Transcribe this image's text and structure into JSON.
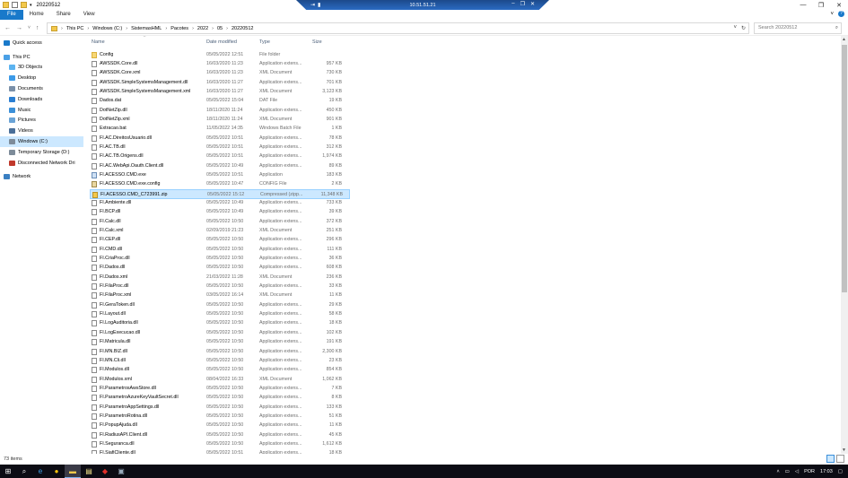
{
  "window": {
    "title": "20220512",
    "quick_access_icons": [
      "save-icon",
      "folder-icon",
      "dropdown-icon"
    ],
    "controls": [
      "—",
      "❐",
      "✕"
    ]
  },
  "rdp_bar": {
    "host_label": "10.51.51.21",
    "left_icons": [
      "pin-icon",
      "signal-icon"
    ],
    "right_controls": [
      "–",
      "❐",
      "✕"
    ]
  },
  "ribbon": {
    "tabs": [
      "File",
      "Home",
      "Share",
      "View"
    ],
    "right_icons": [
      "chevron-down-icon",
      "help-icon"
    ]
  },
  "address": {
    "nav": [
      "←",
      "→",
      "˅",
      "↑"
    ],
    "crumbs": [
      "This PC",
      "Windows (C:)",
      "SistemasHML",
      "Pacotes",
      "2022",
      "05",
      "20220512"
    ],
    "search_placeholder": "Search 20220512"
  },
  "nav_pane": [
    {
      "label": "Quick access",
      "icon": "star-icon",
      "indent": 0,
      "color": "#1979ca"
    },
    {
      "label": "This PC",
      "icon": "computer-icon",
      "indent": 0,
      "color": "#4aa0e6"
    },
    {
      "label": "3D Objects",
      "icon": "cube-icon",
      "indent": 1,
      "color": "#5cb3f0"
    },
    {
      "label": "Desktop",
      "icon": "desktop-icon",
      "indent": 1,
      "color": "#3c9ae8"
    },
    {
      "label": "Documents",
      "icon": "documents-icon",
      "indent": 1,
      "color": "#7a8fa8"
    },
    {
      "label": "Downloads",
      "icon": "download-icon",
      "indent": 1,
      "color": "#2a7ed2"
    },
    {
      "label": "Music",
      "icon": "music-icon",
      "indent": 1,
      "color": "#3a8fd8"
    },
    {
      "label": "Pictures",
      "icon": "pictures-icon",
      "indent": 1,
      "color": "#6aa3d6"
    },
    {
      "label": "Videos",
      "icon": "video-icon",
      "indent": 1,
      "color": "#4a6f99"
    },
    {
      "label": "Windows (C:)",
      "icon": "drive-icon",
      "indent": 1,
      "color": "#7d8b99",
      "selected": true
    },
    {
      "label": "Temporary Storage (D:)",
      "icon": "drive-icon",
      "indent": 1,
      "color": "#7d8b99"
    },
    {
      "label": "Disconnected Network Dri",
      "icon": "network-drive-icon",
      "indent": 1,
      "color": "#c0392b"
    },
    {
      "label": "Network",
      "icon": "network-icon",
      "indent": 0,
      "color": "#3a7fc2"
    }
  ],
  "columns": {
    "name": "Name",
    "date": "Date modified",
    "type": "Type",
    "size": "Size"
  },
  "files": [
    {
      "name": "Config",
      "date": "05/05/2022 12:51",
      "type": "File folder",
      "size": "",
      "kind": "folder"
    },
    {
      "name": "AWSSDK.Core.dll",
      "date": "16/03/2020 11:23",
      "type": "Application extens...",
      "size": "957 KB",
      "kind": "dll"
    },
    {
      "name": "AWSSDK.Core.xml",
      "date": "16/03/2020 11:23",
      "type": "XML Document",
      "size": "730 KB",
      "kind": "xml"
    },
    {
      "name": "AWSSDK.SimpleSystemsManagement.dll",
      "date": "16/03/2020 11:27",
      "type": "Application extens...",
      "size": "701 KB",
      "kind": "dll"
    },
    {
      "name": "AWSSDK.SimpleSystemsManagement.xml",
      "date": "16/03/2020 11:27",
      "type": "XML Document",
      "size": "3,123 KB",
      "kind": "xml"
    },
    {
      "name": "Dados.dat",
      "date": "05/05/2022 15:04",
      "type": "DAT File",
      "size": "19 KB",
      "kind": "file"
    },
    {
      "name": "DotNetZip.dll",
      "date": "18/11/2020 11:24",
      "type": "Application extens...",
      "size": "450 KB",
      "kind": "dll"
    },
    {
      "name": "DotNetZip.xml",
      "date": "18/11/2020 11:24",
      "type": "XML Document",
      "size": "901 KB",
      "kind": "xml"
    },
    {
      "name": "Extracao.bat",
      "date": "11/05/2022 14:35",
      "type": "Windows Batch File",
      "size": "1 KB",
      "kind": "bat"
    },
    {
      "name": "FI.AC.DireitosUsuario.dll",
      "date": "05/05/2022 10:51",
      "type": "Application extens...",
      "size": "78 KB",
      "kind": "dll"
    },
    {
      "name": "FI.AC.TB.dll",
      "date": "05/05/2022 10:51",
      "type": "Application extens...",
      "size": "312 KB",
      "kind": "dll"
    },
    {
      "name": "FI.AC.TB.Origens.dll",
      "date": "05/05/2022 10:51",
      "type": "Application extens...",
      "size": "1,974 KB",
      "kind": "dll"
    },
    {
      "name": "FI.AC.WebApi.Oauth.Client.dll",
      "date": "05/05/2022 10:49",
      "type": "Application extens...",
      "size": "89 KB",
      "kind": "dll"
    },
    {
      "name": "FI.ACESSO.CMD.exe",
      "date": "05/05/2022 10:51",
      "type": "Application",
      "size": "183 KB",
      "kind": "exe"
    },
    {
      "name": "FI.ACESSO.CMD.exe.config",
      "date": "05/05/2022 10:47",
      "type": "CONFIG File",
      "size": "2 KB",
      "kind": "cfg"
    },
    {
      "name": "FI.ACESSO.CMD_C723991.zip",
      "date": "05/05/2022 15:12",
      "type": "Compressed (zipp...",
      "size": "11,348 KB",
      "kind": "zip",
      "selected": true
    },
    {
      "name": "FI.Ambiente.dll",
      "date": "05/05/2022 10:49",
      "type": "Application extens...",
      "size": "733 KB",
      "kind": "dll"
    },
    {
      "name": "FI.BCP.dll",
      "date": "05/05/2022 10:49",
      "type": "Application extens...",
      "size": "39 KB",
      "kind": "dll"
    },
    {
      "name": "FI.Calc.dll",
      "date": "05/05/2022 10:50",
      "type": "Application extens...",
      "size": "372 KB",
      "kind": "dll"
    },
    {
      "name": "FI.Calc.xml",
      "date": "02/09/2019 21:23",
      "type": "XML Document",
      "size": "251 KB",
      "kind": "xml"
    },
    {
      "name": "FI.CEP.dll",
      "date": "05/05/2022 10:50",
      "type": "Application extens...",
      "size": "296 KB",
      "kind": "dll"
    },
    {
      "name": "FI.CMD.dll",
      "date": "05/05/2022 10:50",
      "type": "Application extens...",
      "size": "111 KB",
      "kind": "dll"
    },
    {
      "name": "FI.CriaProc.dll",
      "date": "05/05/2022 10:50",
      "type": "Application extens...",
      "size": "36 KB",
      "kind": "dll"
    },
    {
      "name": "FI.Dados.dll",
      "date": "05/05/2022 10:50",
      "type": "Application extens...",
      "size": "608 KB",
      "kind": "dll"
    },
    {
      "name": "FI.Dados.xml",
      "date": "21/03/2022 11:28",
      "type": "XML Document",
      "size": "236 KB",
      "kind": "xml"
    },
    {
      "name": "FI.FilaProc.dll",
      "date": "05/05/2022 10:50",
      "type": "Application extens...",
      "size": "33 KB",
      "kind": "dll"
    },
    {
      "name": "FI.FilaProc.xml",
      "date": "03/05/2022 16:14",
      "type": "XML Document",
      "size": "11 KB",
      "kind": "xml"
    },
    {
      "name": "FI.GeraToken.dll",
      "date": "05/05/2022 10:50",
      "type": "Application extens...",
      "size": "29 KB",
      "kind": "dll"
    },
    {
      "name": "FI.Layout.dll",
      "date": "05/05/2022 10:50",
      "type": "Application extens...",
      "size": "58 KB",
      "kind": "dll"
    },
    {
      "name": "FI.LogAuditoria.dll",
      "date": "05/05/2022 10:50",
      "type": "Application extens...",
      "size": "18 KB",
      "kind": "dll"
    },
    {
      "name": "FI.LogExecucao.dll",
      "date": "05/05/2022 10:50",
      "type": "Application extens...",
      "size": "102 KB",
      "kind": "dll"
    },
    {
      "name": "FI.Matricula.dll",
      "date": "05/05/2022 10:50",
      "type": "Application extens...",
      "size": "191 KB",
      "kind": "dll"
    },
    {
      "name": "FI.MN.BIZ.dll",
      "date": "05/05/2022 10:50",
      "type": "Application extens...",
      "size": "2,300 KB",
      "kind": "dll"
    },
    {
      "name": "FI.MN.Cli.dll",
      "date": "05/05/2022 10:50",
      "type": "Application extens...",
      "size": "23 KB",
      "kind": "dll"
    },
    {
      "name": "FI.Modulos.dll",
      "date": "05/05/2022 10:50",
      "type": "Application extens...",
      "size": "854 KB",
      "kind": "dll"
    },
    {
      "name": "FI.Modulos.xml",
      "date": "08/04/2022 16:33",
      "type": "XML Document",
      "size": "1,062 KB",
      "kind": "xml"
    },
    {
      "name": "FI.ParametrosAwsStore.dll",
      "date": "05/05/2022 10:50",
      "type": "Application extens...",
      "size": "7 KB",
      "kind": "dll"
    },
    {
      "name": "FI.ParametroAzureKeyVaultSecret.dll",
      "date": "05/05/2022 10:50",
      "type": "Application extens...",
      "size": "8 KB",
      "kind": "dll"
    },
    {
      "name": "FI.ParametroAppSettings.dll",
      "date": "05/05/2022 10:50",
      "type": "Application extens...",
      "size": "133 KB",
      "kind": "dll"
    },
    {
      "name": "FI.ParametroRotina.dll",
      "date": "05/05/2022 10:50",
      "type": "Application extens...",
      "size": "51 KB",
      "kind": "dll"
    },
    {
      "name": "FI.PopupAjuda.dll",
      "date": "05/05/2022 10:50",
      "type": "Application extens...",
      "size": "11 KB",
      "kind": "dll"
    },
    {
      "name": "FI.RadiusAPI.Client.dll",
      "date": "05/05/2022 10:50",
      "type": "Application extens...",
      "size": "45 KB",
      "kind": "dll"
    },
    {
      "name": "FI.Seguranca.dll",
      "date": "05/05/2022 10:50",
      "type": "Application extens...",
      "size": "1,612 KB",
      "kind": "dll"
    },
    {
      "name": "FI.SiafiCliente.dll",
      "date": "05/05/2022 10:51",
      "type": "Application extens...",
      "size": "18 KB",
      "kind": "dll"
    }
  ],
  "status": {
    "items_count": "73 items"
  },
  "taskbar": {
    "apps": [
      "start-icon",
      "search-icon",
      "edge-icon",
      "chrome-icon",
      "file-explorer-icon",
      "notes-icon",
      "acrobat-icon",
      "app-icon"
    ],
    "tray_lang": "POR",
    "clock": "17:03"
  },
  "colors": {
    "accent": "#1979ca",
    "selection": "#cce8ff",
    "taskbar": "#0c0c14"
  }
}
